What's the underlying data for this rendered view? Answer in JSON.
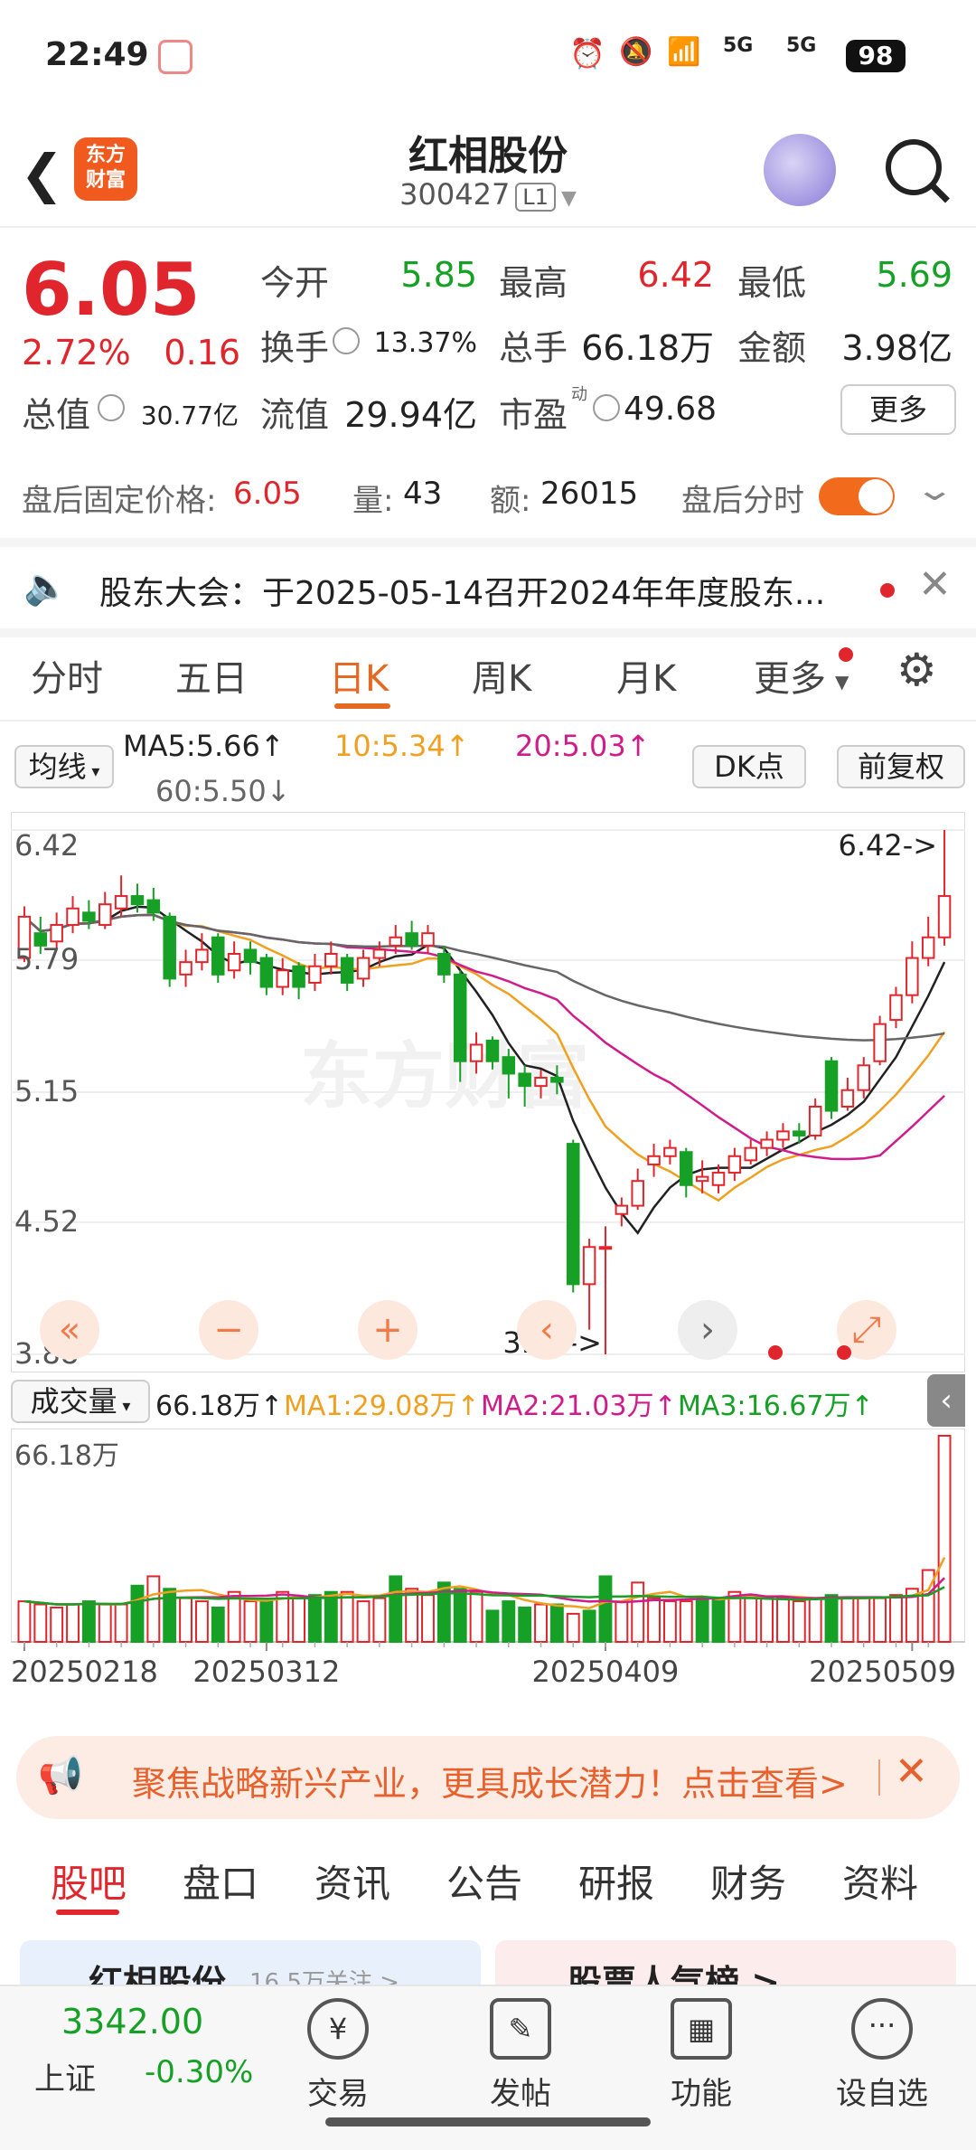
{
  "status_bar": {
    "time": "22:49",
    "battery": "98",
    "signal1": "5G",
    "signal2": "5G"
  },
  "header": {
    "title": "红相股份",
    "code": "300427",
    "market_badge": "L1"
  },
  "quote": {
    "price": "6.05",
    "change_pct": "2.72%",
    "change": "0.16",
    "open_label": "今开",
    "open": "5.85",
    "high_label": "最高",
    "high": "6.42",
    "low_label": "最低",
    "low": "5.69",
    "turnover_label": "换手",
    "turnover": "13.37%",
    "volume_label": "总手",
    "volume": "66.18万",
    "amount_label": "金额",
    "amount": "3.98亿",
    "mktcap_label": "总值",
    "mktcap": "30.77亿",
    "float_label": "流值",
    "float": "29.94亿",
    "pe_label": "市盈",
    "pe_sup": "动",
    "pe": "49.68",
    "more": "更多"
  },
  "after_hours": {
    "price_label": "盘后固定价格:",
    "price": "6.05",
    "vol_label": "量:",
    "vol": "43",
    "amt_label": "额:",
    "amt": "26015",
    "toggle_label": "盘后分时"
  },
  "notice": {
    "text": "股东大会：于2025-05-14召开2024年年度股东..."
  },
  "chart_tabs": [
    "分时",
    "五日",
    "日K",
    "周K",
    "月K",
    "更多"
  ],
  "ma_bar": {
    "mode": "均线",
    "ma5": "MA5:5.66↑",
    "ma10": "10:5.34↑",
    "ma20": "20:5.03↑",
    "ma60": "60:5.50↓",
    "dk": "DK点",
    "adjust": "前复权"
  },
  "chart_data": [
    {
      "type": "candlestick",
      "y_ticks": [
        "6.42",
        "5.79",
        "5.15",
        "4.52",
        "3.88"
      ],
      "ylim": [
        3.88,
        6.42
      ],
      "high_marker": "6.42->",
      "low_marker": "3.88->",
      "candles": [
        {
          "o": 5.8,
          "c": 6.0,
          "h": 6.05,
          "l": 5.78
        },
        {
          "o": 5.92,
          "c": 5.86,
          "h": 6.0,
          "l": 5.82
        },
        {
          "o": 5.88,
          "c": 5.96,
          "h": 6.02,
          "l": 5.84
        },
        {
          "o": 5.96,
          "c": 6.04,
          "h": 6.1,
          "l": 5.92
        },
        {
          "o": 6.02,
          "c": 5.98,
          "h": 6.08,
          "l": 5.94
        },
        {
          "o": 5.96,
          "c": 6.06,
          "h": 6.12,
          "l": 5.94
        },
        {
          "o": 6.04,
          "c": 6.1,
          "h": 6.2,
          "l": 6.0
        },
        {
          "o": 6.1,
          "c": 6.06,
          "h": 6.16,
          "l": 6.02
        },
        {
          "o": 6.08,
          "c": 6.02,
          "h": 6.14,
          "l": 5.98
        },
        {
          "o": 6.0,
          "c": 5.7,
          "h": 6.02,
          "l": 5.66
        },
        {
          "o": 5.72,
          "c": 5.78,
          "h": 5.84,
          "l": 5.66
        },
        {
          "o": 5.78,
          "c": 5.84,
          "h": 5.92,
          "l": 5.74
        },
        {
          "o": 5.9,
          "c": 5.72,
          "h": 5.92,
          "l": 5.68
        },
        {
          "o": 5.74,
          "c": 5.82,
          "h": 5.88,
          "l": 5.7
        },
        {
          "o": 5.84,
          "c": 5.78,
          "h": 5.88,
          "l": 5.72
        },
        {
          "o": 5.8,
          "c": 5.66,
          "h": 5.82,
          "l": 5.62
        },
        {
          "o": 5.66,
          "c": 5.74,
          "h": 5.8,
          "l": 5.62
        },
        {
          "o": 5.76,
          "c": 5.66,
          "h": 5.78,
          "l": 5.6
        },
        {
          "o": 5.68,
          "c": 5.76,
          "h": 5.82,
          "l": 5.64
        },
        {
          "o": 5.76,
          "c": 5.82,
          "h": 5.88,
          "l": 5.72
        },
        {
          "o": 5.8,
          "c": 5.68,
          "h": 5.82,
          "l": 5.64
        },
        {
          "o": 5.7,
          "c": 5.8,
          "h": 5.84,
          "l": 5.66
        },
        {
          "o": 5.8,
          "c": 5.84,
          "h": 5.88,
          "l": 5.76
        },
        {
          "o": 5.86,
          "c": 5.9,
          "h": 5.96,
          "l": 5.82
        },
        {
          "o": 5.92,
          "c": 5.86,
          "h": 5.98,
          "l": 5.84
        },
        {
          "o": 5.86,
          "c": 5.92,
          "h": 5.96,
          "l": 5.82
        },
        {
          "o": 5.82,
          "c": 5.72,
          "h": 5.86,
          "l": 5.68
        },
        {
          "o": 5.72,
          "c": 5.3,
          "h": 5.74,
          "l": 5.2
        },
        {
          "o": 5.3,
          "c": 5.38,
          "h": 5.44,
          "l": 5.24
        },
        {
          "o": 5.4,
          "c": 5.3,
          "h": 5.42,
          "l": 5.26
        },
        {
          "o": 5.32,
          "c": 5.24,
          "h": 5.36,
          "l": 5.12
        },
        {
          "o": 5.24,
          "c": 5.18,
          "h": 5.28,
          "l": 5.08
        },
        {
          "o": 5.18,
          "c": 5.22,
          "h": 5.26,
          "l": 5.12
        },
        {
          "o": 5.22,
          "c": 5.2,
          "h": 5.28,
          "l": 5.14
        },
        {
          "o": 4.9,
          "c": 4.22,
          "h": 4.92,
          "l": 4.18
        },
        {
          "o": 4.22,
          "c": 4.4,
          "h": 4.44,
          "l": 4.0
        },
        {
          "o": 4.4,
          "c": 4.4,
          "h": 4.5,
          "l": 3.88
        },
        {
          "o": 4.56,
          "c": 4.6,
          "h": 4.64,
          "l": 4.5
        },
        {
          "o": 4.6,
          "c": 4.72,
          "h": 4.78,
          "l": 4.58
        },
        {
          "o": 4.8,
          "c": 4.84,
          "h": 4.9,
          "l": 4.74
        },
        {
          "o": 4.84,
          "c": 4.88,
          "h": 4.92,
          "l": 4.8
        },
        {
          "o": 4.86,
          "c": 4.7,
          "h": 4.88,
          "l": 4.64
        },
        {
          "o": 4.72,
          "c": 4.74,
          "h": 4.82,
          "l": 4.66
        },
        {
          "o": 4.7,
          "c": 4.76,
          "h": 4.8,
          "l": 4.66
        },
        {
          "o": 4.76,
          "c": 4.84,
          "h": 4.88,
          "l": 4.72
        },
        {
          "o": 4.82,
          "c": 4.88,
          "h": 4.92,
          "l": 4.8
        },
        {
          "o": 4.88,
          "c": 4.92,
          "h": 4.96,
          "l": 4.84
        },
        {
          "o": 4.92,
          "c": 4.96,
          "h": 5.0,
          "l": 4.88
        },
        {
          "o": 4.96,
          "c": 4.94,
          "h": 5.0,
          "l": 4.9
        },
        {
          "o": 4.94,
          "c": 5.08,
          "h": 5.12,
          "l": 4.92
        },
        {
          "o": 5.3,
          "c": 5.06,
          "h": 5.32,
          "l": 5.02
        },
        {
          "o": 5.08,
          "c": 5.16,
          "h": 5.22,
          "l": 5.06
        },
        {
          "o": 5.16,
          "c": 5.28,
          "h": 5.32,
          "l": 5.12
        },
        {
          "o": 5.3,
          "c": 5.48,
          "h": 5.52,
          "l": 5.28
        },
        {
          "o": 5.5,
          "c": 5.62,
          "h": 5.66,
          "l": 5.46
        },
        {
          "o": 5.62,
          "c": 5.8,
          "h": 5.88,
          "l": 5.58
        },
        {
          "o": 5.8,
          "c": 5.9,
          "h": 6.0,
          "l": 5.76
        },
        {
          "o": 5.9,
          "c": 6.1,
          "h": 6.42,
          "l": 5.86
        }
      ]
    },
    {
      "type": "bar",
      "title": "成交量",
      "y_tick": "66.18万",
      "x_labels": [
        "20250218",
        "20250312",
        "20250409",
        "20250509"
      ],
      "values": [
        13,
        12,
        11,
        12,
        13,
        12,
        12,
        18,
        21,
        17,
        14,
        13,
        11,
        16,
        13,
        13,
        16,
        14,
        15,
        16,
        16,
        13,
        14,
        21,
        17,
        15,
        19,
        17,
        16,
        10,
        13,
        11,
        12,
        12,
        9,
        10,
        21,
        13,
        19,
        14,
        13,
        13,
        14,
        14,
        16,
        15,
        14,
        14,
        13,
        14,
        15,
        14,
        14,
        14,
        15,
        17,
        23,
        66
      ],
      "up": [
        1,
        1,
        1,
        1,
        0,
        1,
        1,
        0,
        1,
        0,
        1,
        1,
        0,
        1,
        1,
        0,
        1,
        1,
        0,
        0,
        1,
        1,
        1,
        0,
        1,
        1,
        0,
        0,
        1,
        0,
        0,
        0,
        1,
        0,
        1,
        0,
        0,
        1,
        1,
        1,
        1,
        1,
        0,
        0,
        1,
        1,
        1,
        1,
        1,
        1,
        0,
        1,
        1,
        1,
        1,
        1,
        1,
        1
      ]
    }
  ],
  "volume_bar": {
    "mode": "成交量",
    "vol": "66.18万↑",
    "ma1": "MA1:29.08万↑",
    "ma2": "MA2:21.03万↑",
    "ma3": "MA3:16.67万↑"
  },
  "ad": {
    "text": "聚焦战略新兴产业，更具成长潜力！点击查看>"
  },
  "bottom_tabs": [
    "股吧",
    "盘口",
    "资讯",
    "公告",
    "研报",
    "财务",
    "资料"
  ],
  "forum_peek": {
    "left": "红相股份",
    "left_sub": "16.5万关注 >",
    "right": "股票人气榜 >"
  },
  "bottom_bar": {
    "index_value": "3342.00",
    "index_name": "上证",
    "index_change": "-0.30%",
    "trade": "交易",
    "post": "发帖",
    "func": "功能",
    "watch": "设自选"
  },
  "colors": {
    "up": "#e0262c",
    "down": "#16a026",
    "accent": "#e46a24",
    "ma5": "#222222",
    "ma10": "#f0a020",
    "ma20": "#d01c8b",
    "ma60": "#666666"
  }
}
